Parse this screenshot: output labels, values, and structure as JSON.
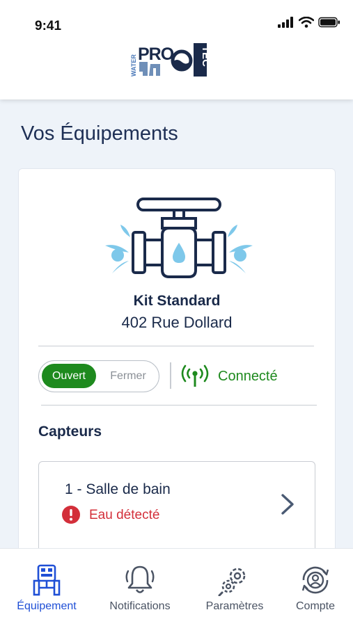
{
  "status_bar": {
    "time": "9:41"
  },
  "brand": {
    "water": "WATER",
    "pro": "PRO",
    "tec": "TEC"
  },
  "page": {
    "title": "Vos Équipements"
  },
  "equipment": {
    "kit_name": "Kit Standard",
    "address": "402 Rue Dollard",
    "valve_toggle": {
      "on_label": "Ouvert",
      "off_label": "Fermer",
      "state": "Ouvert"
    },
    "connection_status": "Connecté"
  },
  "sensors": {
    "title": "Capteurs",
    "items": [
      {
        "name": "1 - Salle de bain",
        "status": "Eau détecté"
      }
    ]
  },
  "tabbar": {
    "items": [
      {
        "label": "Équipement",
        "icon": "equipment-icon",
        "active": true
      },
      {
        "label": "Notifications",
        "icon": "bell-icon",
        "active": false
      },
      {
        "label": "Paramètres",
        "icon": "gears-icon",
        "active": false
      },
      {
        "label": "Compte",
        "icon": "account-icon",
        "active": false
      }
    ]
  },
  "colors": {
    "primary": "#1a2a4a",
    "accent": "#1f4fd6",
    "success": "#1e8a1e",
    "danger": "#d32f3a",
    "water": "#7ec8ea"
  }
}
